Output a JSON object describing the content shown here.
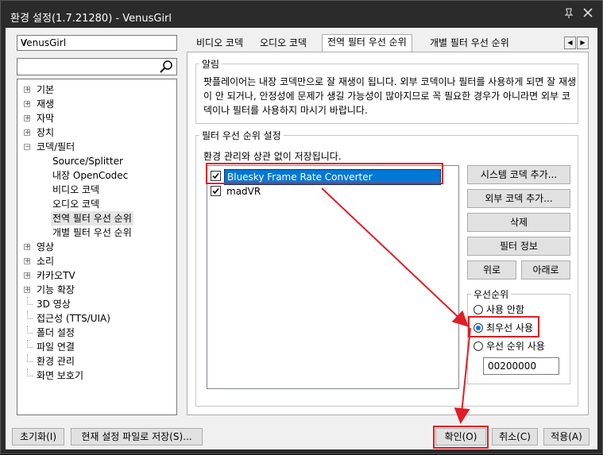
{
  "window": {
    "title": "환경 설정(1.7.21280) - VenusGirl"
  },
  "sidebar": {
    "preset": "VenusGirl",
    "search_placeholder": "",
    "tree": [
      {
        "label": "기본",
        "level": 0,
        "expander": true
      },
      {
        "label": "재생",
        "level": 0,
        "expander": true
      },
      {
        "label": "자막",
        "level": 0,
        "expander": true
      },
      {
        "label": "장치",
        "level": 0,
        "expander": true
      },
      {
        "label": "코덱/필터",
        "level": 0,
        "expander": true,
        "expanded": true
      },
      {
        "label": "Source/Splitter",
        "level": 1
      },
      {
        "label": "내장 OpenCodec",
        "level": 1
      },
      {
        "label": "비디오 코덱",
        "level": 1
      },
      {
        "label": "오디오 코덱",
        "level": 1
      },
      {
        "label": "전역 필터 우선 순위",
        "level": 1,
        "selected": true
      },
      {
        "label": "개별 필터 우선 순위",
        "level": 1
      },
      {
        "label": "영상",
        "level": 0,
        "expander": true
      },
      {
        "label": "소리",
        "level": 0,
        "expander": true
      },
      {
        "label": "카카오TV",
        "level": 0,
        "expander": true
      },
      {
        "label": "기능 확장",
        "level": 0,
        "expander": true
      },
      {
        "label": "3D 영상",
        "level": 0
      },
      {
        "label": "접근성 (TTS/UIA)",
        "level": 0
      },
      {
        "label": "폴더 설정",
        "level": 0
      },
      {
        "label": "파일 연결",
        "level": 0
      },
      {
        "label": "환경 관리",
        "level": 0
      },
      {
        "label": "화면 보호기",
        "level": 0
      }
    ]
  },
  "tabs": [
    "비디오 코덱",
    "오디오 코덱",
    "전역 필터 우선 순위",
    "개별 필터 우선 순위"
  ],
  "active_tab": 2,
  "notice": {
    "legend": "알림",
    "text": "팟플레이어는 내장 코덱만으로 잘 재생이 됩니다. 외부 코덱이나 필터를 사용하게 되면 잘 재생이 안 되거나, 안정성에 문제가 생길 가능성이 많아지므로 꼭 필요한 경우가 아니라면 외부 코덱이나 필터를 사용하지 마시기 바랍니다."
  },
  "priority": {
    "legend": "필터 우선 순위 설정",
    "desc": "환경 관리와 상관 없이 저장됩니다.",
    "items": [
      {
        "label": "Bluesky Frame Rate Converter",
        "checked": true,
        "selected": true
      },
      {
        "label": "madVR",
        "checked": true,
        "selected": false
      }
    ],
    "buttons": {
      "add_system": "시스템 코덱 추가...",
      "add_external": "외부 코덱 추가...",
      "delete": "삭제",
      "filter_info": "필터 정보",
      "up": "위로",
      "down": "아래로"
    },
    "order": {
      "legend": "우선순위",
      "options": [
        "사용 안함",
        "최우선 사용",
        "우선 순위 사용"
      ],
      "selected": 1,
      "value": "00200000"
    }
  },
  "footer": {
    "reset": "초기화(I)",
    "save_current": "현재 설정 파일로 저장(S)...",
    "ok": "확인(O)",
    "cancel": "취소(C)",
    "apply": "적용(A)"
  },
  "colors": {
    "accent": "#0078d7",
    "highlight": "#e01e24",
    "titlebar": "#2b2b2b"
  }
}
